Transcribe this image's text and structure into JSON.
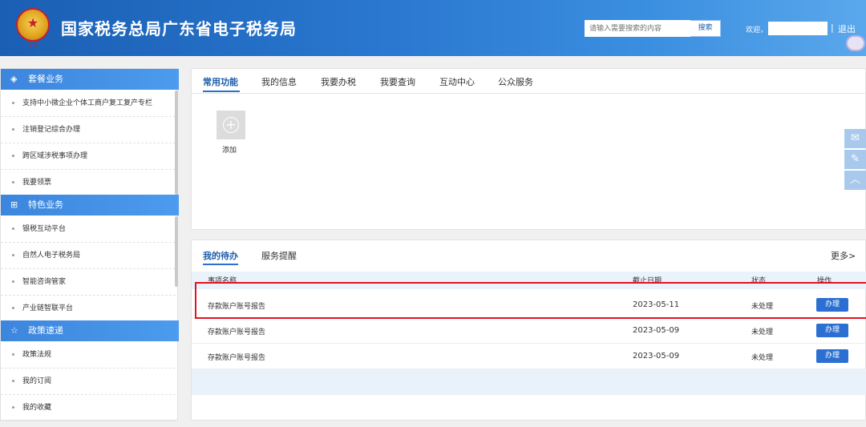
{
  "header": {
    "title": "国家税务总局广东省电子税务局",
    "emblem_icon": "national-emblem-icon",
    "search_placeholder": "请输入需要搜索的内容",
    "search_button": "搜索",
    "welcome": "欢迎，",
    "separator": "|",
    "logout": "退出"
  },
  "sidebar": {
    "sections": [
      {
        "title": "套餐业务",
        "icon": "cube-icon",
        "items": [
          "支持中小微企业个体工商户复工复产专栏",
          "注销登记综合办理",
          "跨区域涉税事项办理",
          "我要领票"
        ]
      },
      {
        "title": "特色业务",
        "icon": "grid-icon",
        "items": [
          "银税互动平台",
          "自然人电子税务局",
          "智能咨询管家",
          "产业链智联平台"
        ]
      },
      {
        "title": "政策速递",
        "icon": "star-icon",
        "items": [
          "政策法规",
          "我的订阅",
          "我的收藏"
        ]
      }
    ]
  },
  "top_panel": {
    "tabs": [
      "常用功能",
      "我的信息",
      "我要办税",
      "我要查询",
      "互动中心",
      "公众服务"
    ],
    "active_tab": 0,
    "add_label": "添加"
  },
  "right_tools": [
    "chat-icon",
    "edit-icon",
    "chevron-up-icon"
  ],
  "todo_panel": {
    "tabs": [
      "我的待办",
      "服务提醒"
    ],
    "active_tab": 0,
    "more": "更多>",
    "columns": [
      "事项名称",
      "截止日期",
      "状态",
      "操作"
    ],
    "rows": [
      {
        "name": "存款账户账号报告",
        "deadline": "2023-05-11",
        "status": "未处理",
        "action": "办理",
        "highlighted": true
      },
      {
        "name": "存款账户账号报告",
        "deadline": "2023-05-09",
        "status": "未处理",
        "action": "办理",
        "highlighted": false
      },
      {
        "name": "存款账户账号报告",
        "deadline": "2023-05-09",
        "status": "未处理",
        "action": "办理",
        "highlighted": false
      }
    ]
  },
  "colors": {
    "header_blue": "#2a78d0",
    "accent_blue": "#2a6fd1",
    "highlight_red": "#e0141e"
  }
}
